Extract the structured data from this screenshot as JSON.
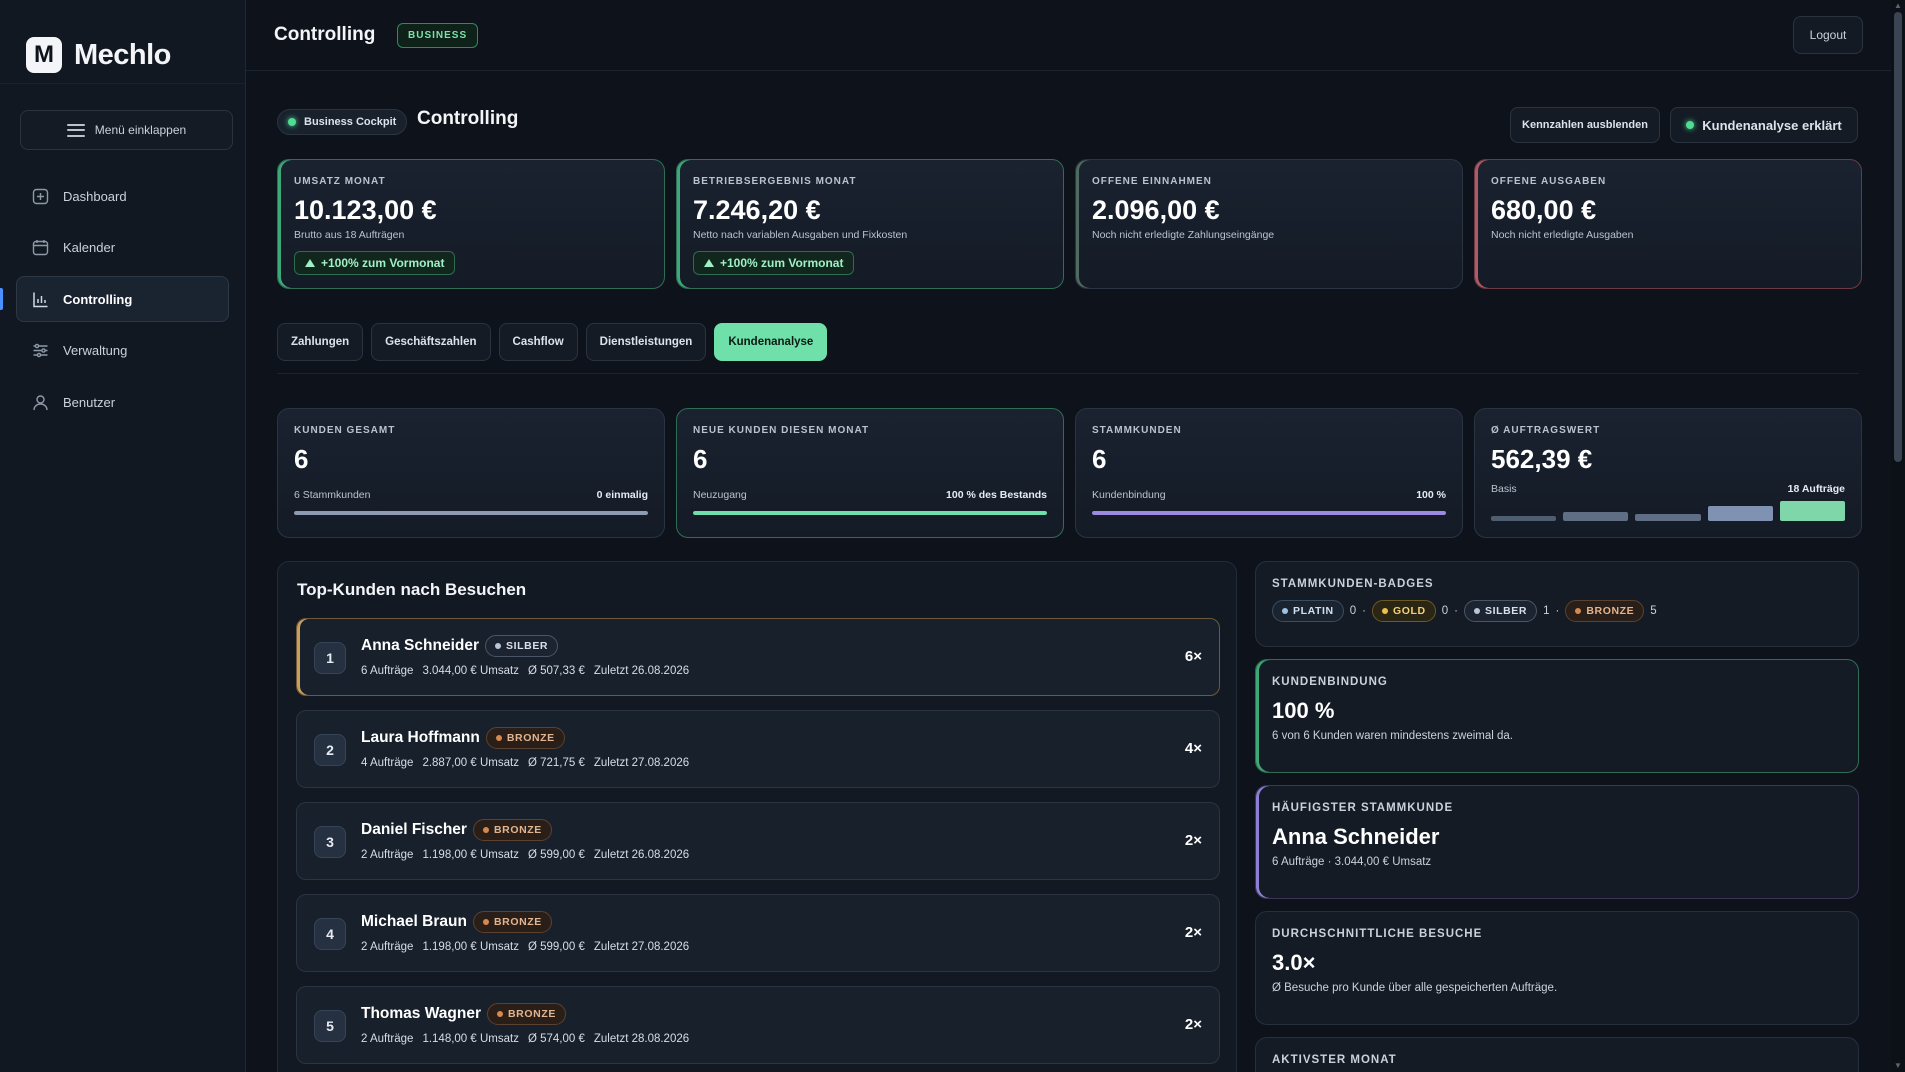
{
  "brand": {
    "logo_letter": "M",
    "name": "Mechlo"
  },
  "sidebar": {
    "collapse_label": "Menü einklappen",
    "items": [
      {
        "label": "Dashboard",
        "icon": "plus-square-icon"
      },
      {
        "label": "Kalender",
        "icon": "calendar-icon"
      },
      {
        "label": "Controlling",
        "icon": "bar-chart-icon",
        "active": true
      },
      {
        "label": "Verwaltung",
        "icon": "sliders-icon"
      },
      {
        "label": "Benutzer",
        "icon": "user-icon"
      }
    ]
  },
  "topbar": {
    "title": "Controlling",
    "badge": "BUSINESS",
    "logout": "Logout"
  },
  "header": {
    "pill": "Business Cockpit",
    "title": "Controlling",
    "btn_hide": "Kennzahlen ausblenden",
    "btn_explain": "Kundenanalyse erklärt"
  },
  "kpis": [
    {
      "label": "UMSATZ MONAT",
      "value": "10.123,00 €",
      "sub": "Brutto aus 18 Aufträgen",
      "trend": "+100% zum Vormonat"
    },
    {
      "label": "BETRIEBSERGEBNIS MONAT",
      "value": "7.246,20 €",
      "sub": "Netto nach variablen Ausgaben und Fixkosten",
      "trend": "+100% zum Vormonat"
    },
    {
      "label": "OFFENE EINNAHMEN",
      "value": "2.096,00 €",
      "sub": "Noch nicht erledigte Zahlungseingänge"
    },
    {
      "label": "OFFENE AUSGABEN",
      "value": "680,00 €",
      "sub": "Noch nicht erledigte Ausgaben"
    }
  ],
  "tabs": [
    "Zahlungen",
    "Geschäftszahlen",
    "Cashflow",
    "Dienstleistungen",
    "Kundenanalyse"
  ],
  "active_tab": "Kundenanalyse",
  "stats": [
    {
      "label": "KUNDEN GESAMT",
      "value": "6",
      "left": "6 Stammkunden",
      "right": "0 einmalig",
      "progress": 1.0,
      "color": "#8f9bb0"
    },
    {
      "label": "NEUE KUNDEN DIESEN MONAT",
      "value": "6",
      "left": "Neuzugang",
      "right": "100 % des Bestands",
      "progress": 1.0,
      "color": "#6fe0aa"
    },
    {
      "label": "STAMMKUNDEN",
      "value": "6",
      "left": "Kundenbindung",
      "right": "100 %",
      "progress": 1.0,
      "color": "#9b8ae0"
    },
    {
      "label": "Ø AUFTRAGSWERT",
      "value": "562,39 €",
      "left": "Basis",
      "right": "18 Aufträge"
    }
  ],
  "mini_bars": [
    {
      "level": 0.25,
      "color": "#4f5d70"
    },
    {
      "level": 0.45,
      "color": "#5f6e84"
    },
    {
      "level": 0.35,
      "color": "#5f6e84"
    },
    {
      "level": 0.75,
      "color": "#8092b2"
    },
    {
      "level": 1.0,
      "color": "#7fd6a8"
    }
  ],
  "top_customers": {
    "title": "Top-Kunden nach Besuchen",
    "rows": [
      {
        "rank": "1",
        "name": "Anna Schneider",
        "badge": "SILBER",
        "tier": "silber",
        "orders": "6 Aufträge",
        "revenue": "3.044,00 € Umsatz",
        "avg": "Ø 507,33 €",
        "last": "Zuletzt 26.08.2026",
        "visits": "6×"
      },
      {
        "rank": "2",
        "name": "Laura Hoffmann",
        "badge": "BRONZE",
        "tier": "bronze",
        "orders": "4 Aufträge",
        "revenue": "2.887,00 € Umsatz",
        "avg": "Ø 721,75 €",
        "last": "Zuletzt 27.08.2026",
        "visits": "4×"
      },
      {
        "rank": "3",
        "name": "Daniel Fischer",
        "badge": "BRONZE",
        "tier": "bronze",
        "orders": "2 Aufträge",
        "revenue": "1.198,00 € Umsatz",
        "avg": "Ø 599,00 €",
        "last": "Zuletzt 26.08.2026",
        "visits": "2×"
      },
      {
        "rank": "4",
        "name": "Michael Braun",
        "badge": "BRONZE",
        "tier": "bronze",
        "orders": "2 Aufträge",
        "revenue": "1.198,00 € Umsatz",
        "avg": "Ø 599,00 €",
        "last": "Zuletzt 27.08.2026",
        "visits": "2×"
      },
      {
        "rank": "5",
        "name": "Thomas Wagner",
        "badge": "BRONZE",
        "tier": "bronze",
        "orders": "2 Aufträge",
        "revenue": "1.148,00 € Umsatz",
        "avg": "Ø 574,00 €",
        "last": "Zuletzt 28.08.2026",
        "visits": "2×"
      }
    ]
  },
  "badges_card": {
    "title": "STAMMKUNDEN-BADGES",
    "items": [
      {
        "label": "PLATIN",
        "tier": "platin",
        "count": "0"
      },
      {
        "label": "GOLD",
        "tier": "gold",
        "count": "0"
      },
      {
        "label": "SILBER",
        "tier": "silber",
        "count": "1"
      },
      {
        "label": "BRONZE",
        "tier": "bronze",
        "count": "5"
      }
    ],
    "separator": "·"
  },
  "retention_card": {
    "title": "KUNDENBINDUNG",
    "value": "100 %",
    "sub": "6 von 6 Kunden waren mindestens zweimal da."
  },
  "top_regular_card": {
    "title": "HÄUFIGSTER STAMMKUNDE",
    "value": "Anna Schneider",
    "sub": "6 Aufträge · 3.044,00 € Umsatz"
  },
  "avg_visits_card": {
    "title": "DURCHSCHNITTLICHE BESUCHE",
    "value": "3.0×",
    "sub": "Ø Besuche pro Kunde über alle gespeicherten Aufträge."
  },
  "active_month_card": {
    "title": "AKTIVSTER MONAT"
  }
}
